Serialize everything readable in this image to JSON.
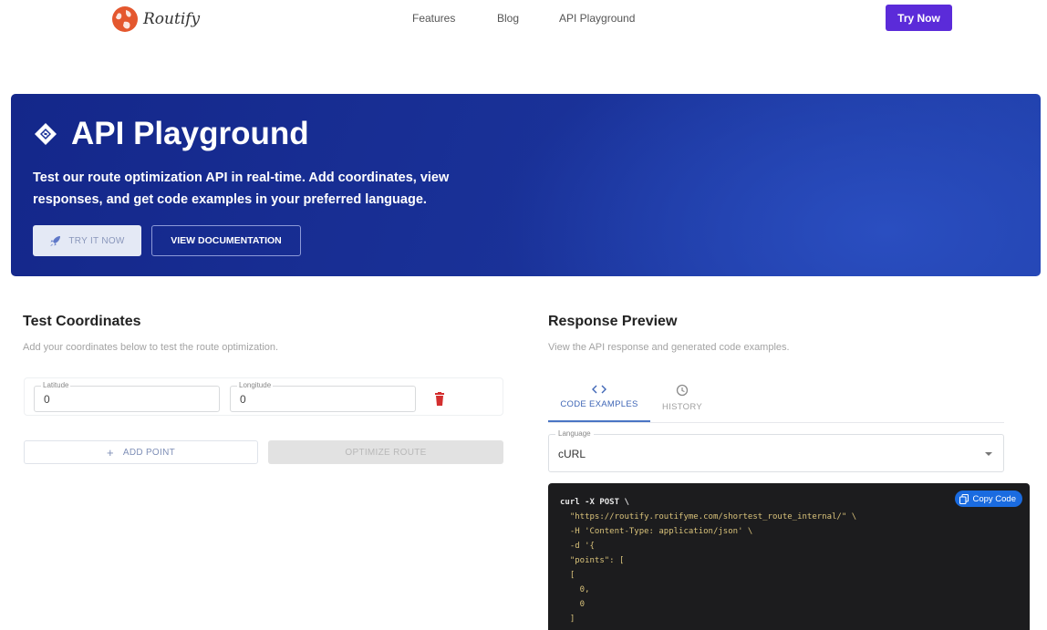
{
  "navbar": {
    "brand": "Routify",
    "links": [
      "Features",
      "Blog",
      "API Playground"
    ],
    "cta": "Try Now"
  },
  "hero": {
    "title": "API Playground",
    "description": "Test our route optimization API in real-time. Add coordinates, view responses, and get code examples in your preferred language.",
    "primary_button": "TRY IT NOW",
    "secondary_button": "VIEW DOCUMENTATION"
  },
  "left_panel": {
    "title": "Test Coordinates",
    "subtitle": "Add your coordinates below to test the route optimization.",
    "points": [
      {
        "latitude_label": "Latitude",
        "latitude_value": "0",
        "longitude_label": "Longitude",
        "longitude_value": "0"
      }
    ],
    "add_button": "ADD POINT",
    "optimize_button": "OPTIMIZE ROUTE"
  },
  "right_panel": {
    "title": "Response Preview",
    "subtitle": "View the API response and generated code examples.",
    "tabs": [
      {
        "label": "CODE EXAMPLES",
        "icon": "code-icon",
        "active": true
      },
      {
        "label": "HISTORY",
        "icon": "history-icon",
        "active": false
      }
    ],
    "language_label": "Language",
    "language_value": "cURL",
    "copy_button": "Copy Code",
    "code_lines": [
      "curl -X POST \\",
      "  \"https://routify.routifyme.com/shortest_route_internal/\" \\",
      "  -H 'Content-Type: application/json' \\",
      "  -d '{",
      "  \"points\": [",
      "  [",
      "    0,",
      "    0",
      "  ]"
    ]
  },
  "colors": {
    "brand_accent": "#5b2bd9",
    "hero_bg": "#1a3299",
    "delete": "#d32f2f",
    "active_tab": "#3f66b6",
    "code_bg": "#1c1c1e",
    "code_string": "#d9c27a",
    "copy_button": "#1a6be0"
  }
}
